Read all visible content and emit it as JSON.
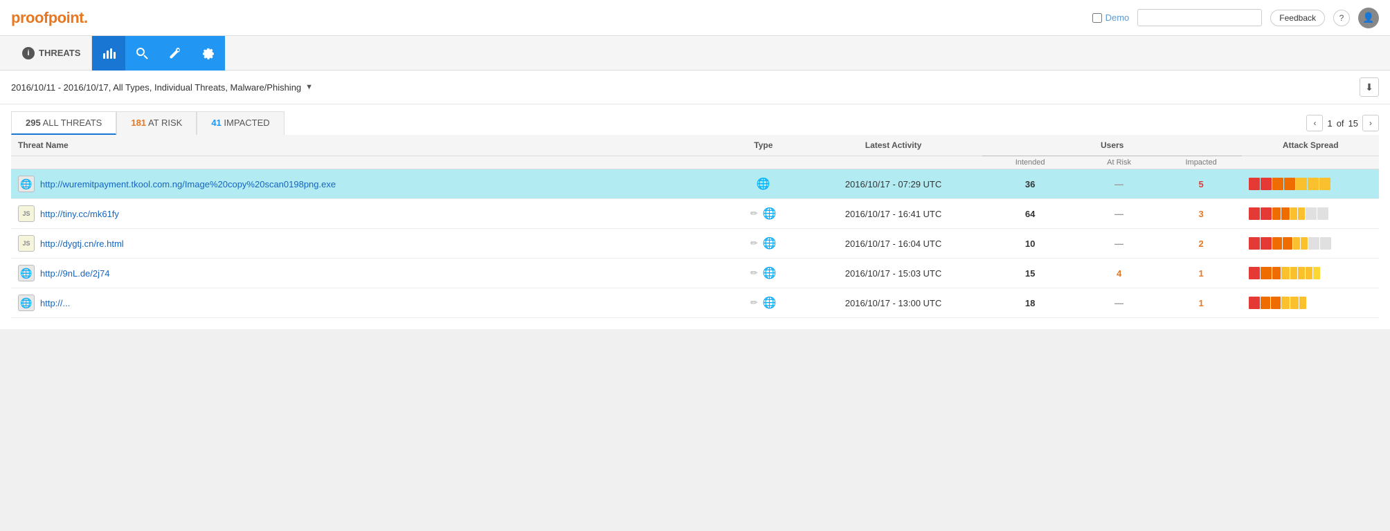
{
  "header": {
    "logo_text": "proofpoint",
    "logo_dot": ".",
    "demo_label": "Demo",
    "search_placeholder": "",
    "feedback_label": "Feedback",
    "help_label": "?",
    "user_icon": "👤"
  },
  "navbar": {
    "section_label": "THREATS",
    "icons": [
      {
        "name": "chart-icon",
        "symbol": "📊",
        "tooltip": "Dashboard"
      },
      {
        "name": "search-icon",
        "symbol": "🔍",
        "tooltip": "Search"
      },
      {
        "name": "wrench-icon",
        "symbol": "🔧",
        "tooltip": "Tools"
      },
      {
        "name": "gear-icon",
        "symbol": "⚙",
        "tooltip": "Settings"
      }
    ]
  },
  "filter": {
    "label": "2016/10/11 - 2016/10/17, All Types, Individual Threats, Malware/Phishing",
    "download_tooltip": "Download"
  },
  "tabs": [
    {
      "id": "all",
      "count": "295",
      "label": "ALL THREATS",
      "active": false
    },
    {
      "id": "at-risk",
      "count": "181",
      "label": "AT RISK",
      "active": false,
      "count_color": "orange"
    },
    {
      "id": "impacted",
      "count": "41",
      "label": "IMPACTED",
      "active": false,
      "count_color": "teal"
    }
  ],
  "pagination": {
    "current": "1",
    "total": "15",
    "of_label": "of"
  },
  "table": {
    "headers": {
      "threat_name": "Threat Name",
      "type": "Type",
      "latest_activity": "Latest Activity",
      "users_group": "Users",
      "intended": "Intended",
      "at_risk": "At Risk",
      "impacted": "Impacted",
      "attack_spread": "Attack Spread"
    },
    "rows": [
      {
        "id": 1,
        "icon_type": "globe",
        "icon_symbol": "🌐",
        "name": "http://wuremitpayment.tkool.com.ng/Image%20copy%20scan0198png.exe",
        "type_icon": "globe",
        "has_pencil": false,
        "activity": "2016/10/17 - 07:29 UTC",
        "intended": "36",
        "at_risk": "—",
        "impacted": "5",
        "impacted_color": "red",
        "at_risk_color": "dash",
        "selected": true,
        "spread": [
          {
            "color": "#e53935",
            "width": 16
          },
          {
            "color": "#e53935",
            "width": 16
          },
          {
            "color": "#ef6c00",
            "width": 16
          },
          {
            "color": "#ef6c00",
            "width": 16
          },
          {
            "color": "#fbc02d",
            "width": 16
          },
          {
            "color": "#fbc02d",
            "width": 16
          },
          {
            "color": "#fbc02d",
            "width": 16
          }
        ]
      },
      {
        "id": 2,
        "icon_type": "js",
        "icon_symbol": "JS",
        "name": "http://tiny.cc/mk61fy",
        "type_icon": "globe",
        "has_pencil": true,
        "activity": "2016/10/17 - 16:41 UTC",
        "intended": "64",
        "at_risk": "—",
        "impacted": "3",
        "impacted_color": "orange",
        "at_risk_color": "dash",
        "selected": false,
        "spread": [
          {
            "color": "#e53935",
            "width": 16
          },
          {
            "color": "#e53935",
            "width": 16
          },
          {
            "color": "#ef6c00",
            "width": 12
          },
          {
            "color": "#ef6c00",
            "width": 12
          },
          {
            "color": "#fbc02d",
            "width": 10
          },
          {
            "color": "#fbc02d",
            "width": 10
          },
          {
            "color": "#e0e0e0",
            "width": 16
          },
          {
            "color": "#e0e0e0",
            "width": 16
          }
        ]
      },
      {
        "id": 3,
        "icon_type": "js",
        "icon_symbol": "JS",
        "name": "http://dygtj.cn/re.html",
        "type_icon": "globe",
        "has_pencil": true,
        "activity": "2016/10/17 - 16:04 UTC",
        "intended": "10",
        "at_risk": "—",
        "impacted": "2",
        "impacted_color": "orange",
        "at_risk_color": "dash",
        "selected": false,
        "spread": [
          {
            "color": "#e53935",
            "width": 16
          },
          {
            "color": "#e53935",
            "width": 16
          },
          {
            "color": "#ef6c00",
            "width": 14
          },
          {
            "color": "#ef6c00",
            "width": 14
          },
          {
            "color": "#fbc02d",
            "width": 10
          },
          {
            "color": "#fbc02d",
            "width": 10
          },
          {
            "color": "#e0e0e0",
            "width": 16
          },
          {
            "color": "#e0e0e0",
            "width": 16
          }
        ]
      },
      {
        "id": 4,
        "icon_type": "globe",
        "icon_symbol": "🌐",
        "name": "http://9nL.de/2j74",
        "type_icon": "globe",
        "has_pencil": true,
        "activity": "2016/10/17 - 15:03 UTC",
        "intended": "15",
        "at_risk": "4",
        "impacted": "1",
        "impacted_color": "orange",
        "at_risk_color": "orange",
        "selected": false,
        "spread": [
          {
            "color": "#e53935",
            "width": 16
          },
          {
            "color": "#ef6c00",
            "width": 16
          },
          {
            "color": "#ef6c00",
            "width": 12
          },
          {
            "color": "#fbc02d",
            "width": 12
          },
          {
            "color": "#fbc02d",
            "width": 10
          },
          {
            "color": "#fbc02d",
            "width": 10
          },
          {
            "color": "#fbc02d",
            "width": 10
          },
          {
            "color": "#fdd835",
            "width": 10
          }
        ]
      },
      {
        "id": 5,
        "icon_type": "globe",
        "icon_symbol": "🌐",
        "name": "http://...",
        "type_icon": "globe",
        "has_pencil": true,
        "activity": "2016/10/17 - 13:00 UTC",
        "intended": "18",
        "at_risk": "—",
        "impacted": "1",
        "impacted_color": "orange",
        "at_risk_color": "dash",
        "selected": false,
        "spread": [
          {
            "color": "#e53935",
            "width": 16
          },
          {
            "color": "#ef6c00",
            "width": 14
          },
          {
            "color": "#ef6c00",
            "width": 14
          },
          {
            "color": "#fbc02d",
            "width": 12
          },
          {
            "color": "#fbc02d",
            "width": 12
          },
          {
            "color": "#fbc02d",
            "width": 10
          }
        ]
      }
    ]
  }
}
